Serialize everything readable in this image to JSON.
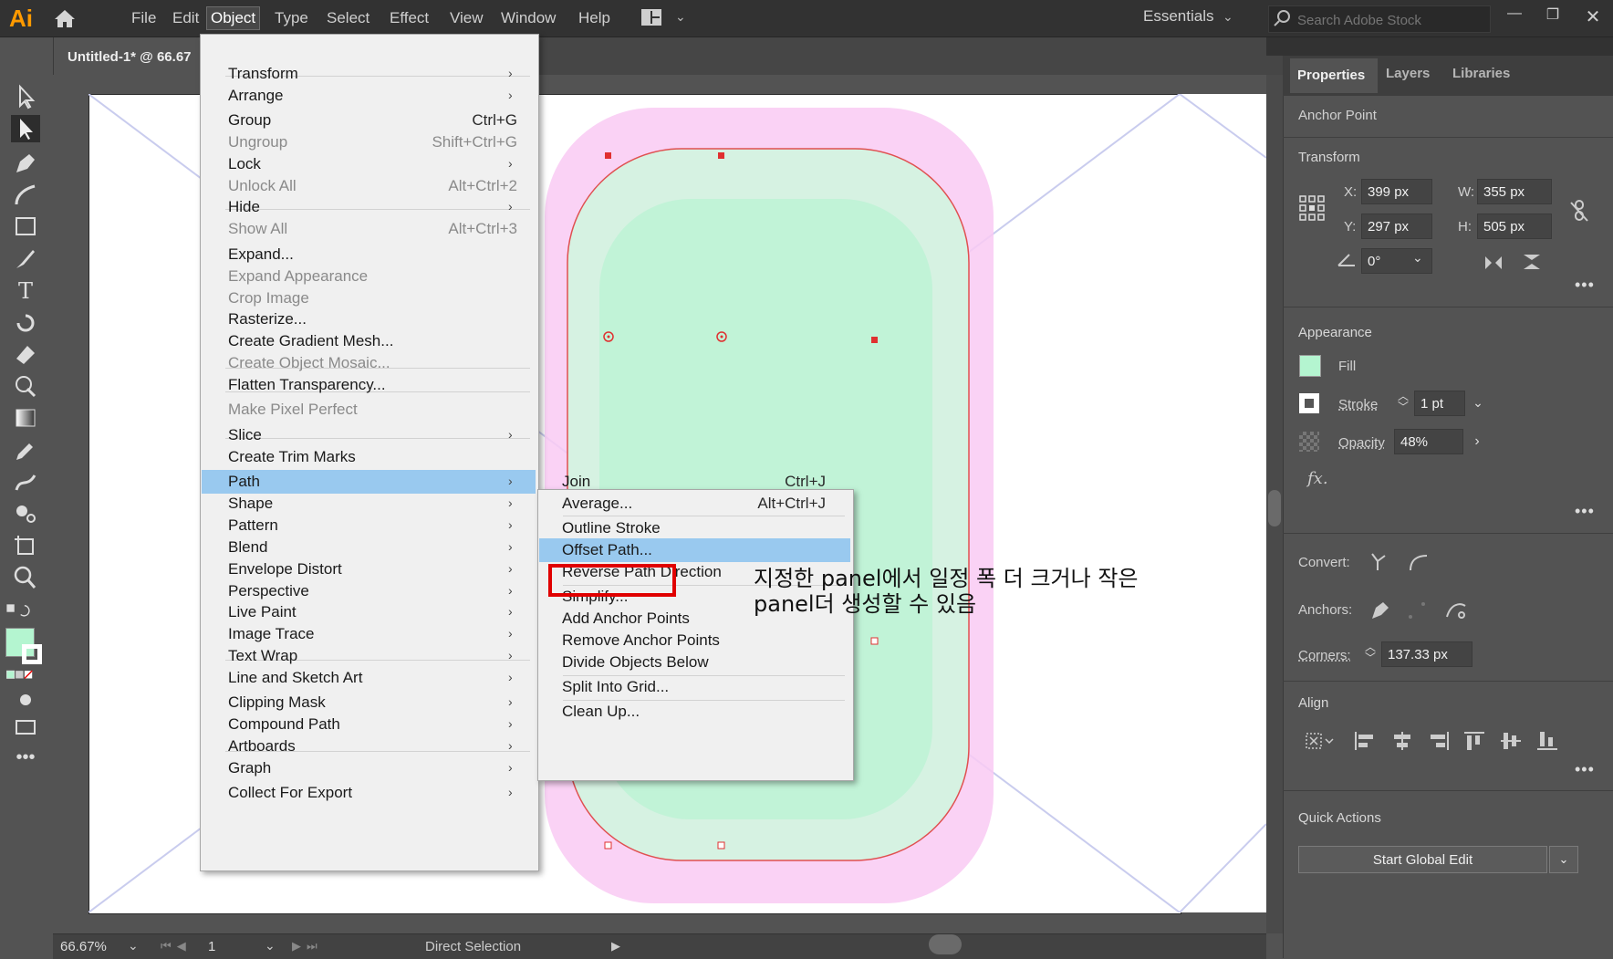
{
  "app": {
    "logo": "Ai"
  },
  "menubar": {
    "items": [
      "File",
      "Edit",
      "Object",
      "Type",
      "Select",
      "Effect",
      "View",
      "Window",
      "Help"
    ],
    "active": "Object",
    "workspace": "Essentials",
    "search_placeholder": "Search Adobe Stock"
  },
  "document": {
    "tab_title": "Untitled-1* @ 66.67"
  },
  "object_menu": {
    "items": [
      {
        "label": "Transform",
        "shortcut": "",
        "submenu": true,
        "disabled": false
      },
      {
        "label": "Arrange",
        "shortcut": "",
        "submenu": true,
        "disabled": false
      },
      {
        "label": "Group",
        "shortcut": "Ctrl+G",
        "submenu": false,
        "disabled": false
      },
      {
        "label": "Ungroup",
        "shortcut": "Shift+Ctrl+G",
        "submenu": false,
        "disabled": true
      },
      {
        "label": "Lock",
        "shortcut": "",
        "submenu": true,
        "disabled": false
      },
      {
        "label": "Unlock All",
        "shortcut": "Alt+Ctrl+2",
        "submenu": false,
        "disabled": true
      },
      {
        "label": "Hide",
        "shortcut": "",
        "submenu": true,
        "disabled": false
      },
      {
        "label": "Show All",
        "shortcut": "Alt+Ctrl+3",
        "submenu": false,
        "disabled": true
      },
      {
        "label": "Expand...",
        "shortcut": "",
        "submenu": false,
        "disabled": false
      },
      {
        "label": "Expand Appearance",
        "shortcut": "",
        "submenu": false,
        "disabled": true
      },
      {
        "label": "Crop Image",
        "shortcut": "",
        "submenu": false,
        "disabled": true
      },
      {
        "label": "Rasterize...",
        "shortcut": "",
        "submenu": false,
        "disabled": false
      },
      {
        "label": "Create Gradient Mesh...",
        "shortcut": "",
        "submenu": false,
        "disabled": false
      },
      {
        "label": "Create Object Mosaic...",
        "shortcut": "",
        "submenu": false,
        "disabled": true
      },
      {
        "label": "Flatten Transparency...",
        "shortcut": "",
        "submenu": false,
        "disabled": false
      },
      {
        "label": "Make Pixel Perfect",
        "shortcut": "",
        "submenu": false,
        "disabled": true
      },
      {
        "label": "Slice",
        "shortcut": "",
        "submenu": true,
        "disabled": false
      },
      {
        "label": "Create Trim Marks",
        "shortcut": "",
        "submenu": false,
        "disabled": false
      },
      {
        "label": "Path",
        "shortcut": "",
        "submenu": true,
        "disabled": false,
        "highlighted": true
      },
      {
        "label": "Shape",
        "shortcut": "",
        "submenu": true,
        "disabled": false
      },
      {
        "label": "Pattern",
        "shortcut": "",
        "submenu": true,
        "disabled": false
      },
      {
        "label": "Blend",
        "shortcut": "",
        "submenu": true,
        "disabled": false
      },
      {
        "label": "Envelope Distort",
        "shortcut": "",
        "submenu": true,
        "disabled": false
      },
      {
        "label": "Perspective",
        "shortcut": "",
        "submenu": true,
        "disabled": false
      },
      {
        "label": "Live Paint",
        "shortcut": "",
        "submenu": true,
        "disabled": false
      },
      {
        "label": "Image Trace",
        "shortcut": "",
        "submenu": true,
        "disabled": false
      },
      {
        "label": "Text Wrap",
        "shortcut": "",
        "submenu": true,
        "disabled": false
      },
      {
        "label": "Line and Sketch Art",
        "shortcut": "",
        "submenu": true,
        "disabled": false
      },
      {
        "label": "Clipping Mask",
        "shortcut": "",
        "submenu": true,
        "disabled": false
      },
      {
        "label": "Compound Path",
        "shortcut": "",
        "submenu": true,
        "disabled": false
      },
      {
        "label": "Artboards",
        "shortcut": "",
        "submenu": true,
        "disabled": false
      },
      {
        "label": "Graph",
        "shortcut": "",
        "submenu": true,
        "disabled": false
      },
      {
        "label": "Collect For Export",
        "shortcut": "",
        "submenu": true,
        "disabled": false
      }
    ]
  },
  "path_submenu": {
    "items": [
      {
        "label": "Join",
        "shortcut": "Ctrl+J"
      },
      {
        "label": "Average...",
        "shortcut": "Alt+Ctrl+J"
      },
      {
        "label": "Outline Stroke",
        "shortcut": ""
      },
      {
        "label": "Offset Path...",
        "shortcut": "",
        "highlighted": true
      },
      {
        "label": "Reverse Path Direction",
        "shortcut": ""
      },
      {
        "label": "Simplify...",
        "shortcut": ""
      },
      {
        "label": "Add Anchor Points",
        "shortcut": ""
      },
      {
        "label": "Remove Anchor Points",
        "shortcut": ""
      },
      {
        "label": "Divide Objects Below",
        "shortcut": ""
      },
      {
        "label": "Split Into Grid...",
        "shortcut": ""
      },
      {
        "label": "Clean Up...",
        "shortcut": ""
      }
    ]
  },
  "annotation": {
    "line1": "지정한 panel에서 일정 폭 더 크거나 작은",
    "line2": "panel더 생성할 수 있음"
  },
  "properties_panel": {
    "tabs": [
      "Properties",
      "Layers",
      "Libraries"
    ],
    "selection_label": "Anchor Point",
    "transform": {
      "title": "Transform",
      "x_label": "X:",
      "x": "399 px",
      "y_label": "Y:",
      "y": "297 px",
      "w_label": "W:",
      "w": "355 px",
      "h_label": "H:",
      "h": "505 px",
      "rotation": "0°"
    },
    "appearance": {
      "title": "Appearance",
      "fill_label": "Fill",
      "fill_color": "#b4f5d0",
      "stroke_label": "Stroke",
      "stroke_weight": "1 pt",
      "opacity_label": "Opacity",
      "opacity": "48%",
      "fx": "fx."
    },
    "convert_label": "Convert:",
    "anchors_label": "Anchors:",
    "corners_label": "Corners:",
    "corners_value": "137.33 px",
    "align_title": "Align",
    "quick_actions_title": "Quick Actions",
    "start_global_edit": "Start Global Edit"
  },
  "statusbar": {
    "zoom": "66.67%",
    "page": "1",
    "tool": "Direct Selection"
  },
  "colors": {
    "menu_highlight": "#99c9ef",
    "annotation_box": "#e00000",
    "accent_logo": "#FF9A00"
  }
}
